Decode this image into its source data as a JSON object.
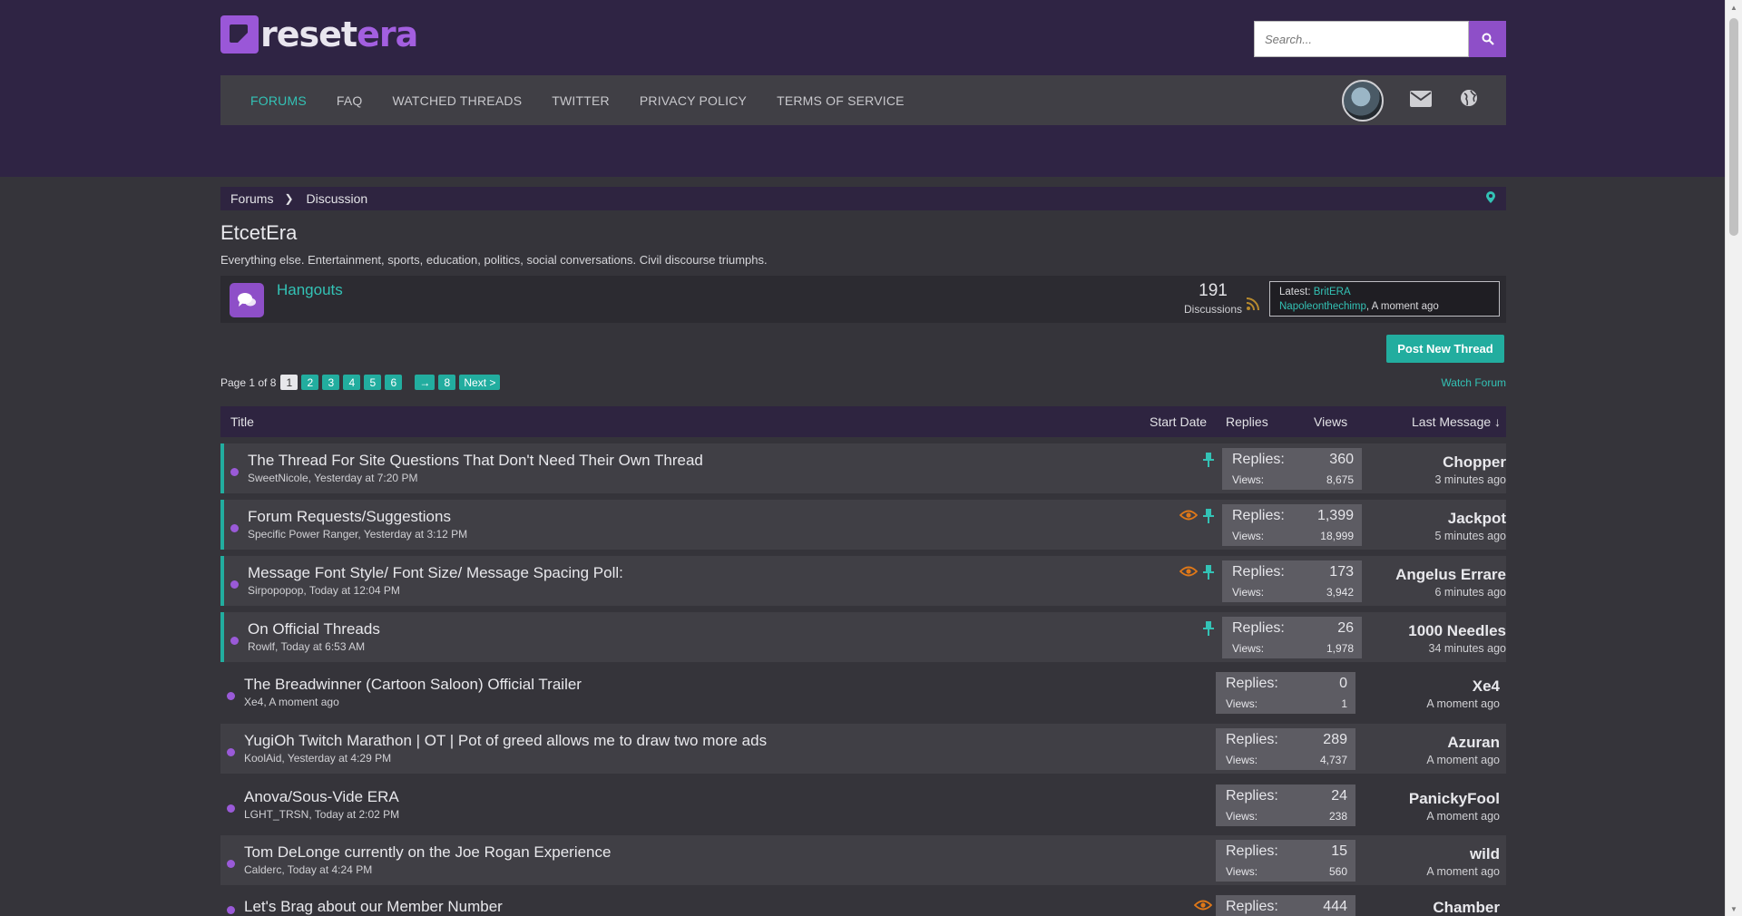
{
  "logo": {
    "reset": "reset",
    "era": "era"
  },
  "search": {
    "placeholder": "Search..."
  },
  "nav": {
    "items": [
      {
        "label": "FORUMS"
      },
      {
        "label": "FAQ"
      },
      {
        "label": "WATCHED THREADS"
      },
      {
        "label": "TWITTER"
      },
      {
        "label": "PRIVACY POLICY"
      },
      {
        "label": "TERMS OF SERVICE"
      }
    ]
  },
  "breadcrumb": {
    "items": [
      "Forums",
      "Discussion"
    ]
  },
  "forum": {
    "title": "EtcetEra",
    "description": "Everything else. Entertainment, sports, education, politics, social conversations. Civil discourse triumphs."
  },
  "hangouts": {
    "name": "Hangouts",
    "count": "191",
    "count_label": "Discussions",
    "latest_label": "Latest:",
    "latest_thread": "BritERA",
    "latest_user": "Napoleonthechimp",
    "latest_time": ", A moment ago"
  },
  "actions": {
    "post_new_thread": "Post New Thread",
    "watch_forum": "Watch Forum"
  },
  "pagination": {
    "label": "Page 1 of 8",
    "pages": [
      "1",
      "2",
      "3",
      "4",
      "5",
      "6"
    ],
    "arrow": "→",
    "last": "8",
    "next": "Next >"
  },
  "table_head": {
    "title": "Title",
    "start_date": "Start Date",
    "replies": "Replies",
    "views": "Views",
    "last_message": "Last Message ↓"
  },
  "stat_labels": {
    "replies": "Replies:",
    "views": "Views:"
  },
  "threads": [
    {
      "title": "The Thread For Site Questions That Don't Need Their Own Thread",
      "meta": "SweetNicole, Yesterday at 7:20 PM",
      "replies": "360",
      "views": "8,675",
      "last_user": "Chopper",
      "last_time": "3 minutes ago"
    },
    {
      "title": "Forum Requests/Suggestions",
      "meta": "Specific Power Ranger, Yesterday at 3:12 PM",
      "replies": "1,399",
      "views": "18,999",
      "last_user": "Jackpot",
      "last_time": "5 minutes ago"
    },
    {
      "title": "Message Font Style/ Font Size/ Message Spacing Poll:",
      "meta": "Sirpopopop, Today at 12:04 PM",
      "replies": "173",
      "views": "3,942",
      "last_user": "Angelus Errare",
      "last_time": "6 minutes ago"
    },
    {
      "title": "On Official Threads",
      "meta": "Rowlf, Today at 6:53 AM",
      "replies": "26",
      "views": "1,978",
      "last_user": "1000 Needles",
      "last_time": "34 minutes ago"
    },
    {
      "title": "The Breadwinner (Cartoon Saloon) Official Trailer",
      "meta": "Xe4, A moment ago",
      "replies": "0",
      "views": "1",
      "last_user": "Xe4",
      "last_time": "A moment ago"
    },
    {
      "title": "YugiOh Twitch Marathon | OT | Pot of greed allows me to draw two more ads",
      "meta": "KoolAid, Yesterday at 4:29 PM",
      "replies": "289",
      "views": "4,737",
      "last_user": "Azuran",
      "last_time": "A moment ago"
    },
    {
      "title": "Anova/Sous-Vide ERA",
      "meta": "LGHT_TRSN, Today at 2:02 PM",
      "replies": "24",
      "views": "238",
      "last_user": "PanickyFool",
      "last_time": "A moment ago"
    },
    {
      "title": "Tom DeLonge currently on the Joe Rogan Experience",
      "meta": "Calderc, Today at 4:24 PM",
      "replies": "15",
      "views": "560",
      "last_user": "wild",
      "last_time": "A moment ago"
    },
    {
      "title": "Let's Brag about our Member Number",
      "meta": "",
      "replies": "444",
      "views": "",
      "last_user": "Chamber",
      "last_time": ""
    }
  ]
}
